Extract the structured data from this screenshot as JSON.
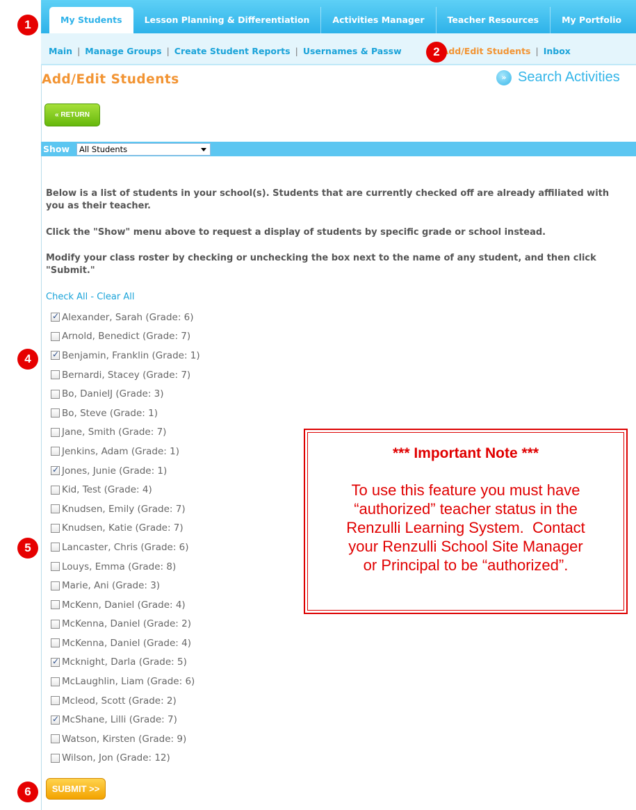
{
  "badges": [
    "1",
    "2",
    "4",
    "5",
    "6"
  ],
  "tabs": [
    "My Students",
    "Lesson Planning & Differentiation",
    "Activities Manager",
    "Teacher Resources",
    "My Portfolio"
  ],
  "subnav": [
    "Main",
    "Manage Groups",
    "Create Student Reports",
    "Usernames & Passw",
    "Add/Edit Students",
    "Inbox"
  ],
  "page_title": "Add/Edit Students",
  "search_activities": "Search Activities",
  "return_label": "« RETURN",
  "show": {
    "label": "Show",
    "selected": "All Students"
  },
  "paragraphs": [
    "Below is a list of students in your school(s). Students that are currently checked off are already affiliated with you as their teacher.",
    "Click the \"Show\" menu above to request a display of students by specific grade or school instead.",
    "Modify your class roster by checking or unchecking the box next to the name of any student, and then click \"Submit.\""
  ],
  "check_all": "Check All",
  "check_sep": " - ",
  "clear_all": "Clear All",
  "students": [
    {
      "name": "Alexander, Sarah (Grade: 6)",
      "checked": true
    },
    {
      "name": "Arnold, Benedict (Grade: 7)",
      "checked": false
    },
    {
      "name": "Benjamin, Franklin (Grade: 1)",
      "checked": true
    },
    {
      "name": "Bernardi, Stacey (Grade: 7)",
      "checked": false
    },
    {
      "name": "Bo, DanielJ (Grade: 3)",
      "checked": false
    },
    {
      "name": "Bo, Steve (Grade: 1)",
      "checked": false
    },
    {
      "name": "Jane, Smith (Grade: 7)",
      "checked": false
    },
    {
      "name": "Jenkins, Adam (Grade: 1)",
      "checked": false
    },
    {
      "name": "Jones, Junie (Grade: 1)",
      "checked": true
    },
    {
      "name": "Kid, Test (Grade: 4)",
      "checked": false
    },
    {
      "name": "Knudsen, Emily (Grade: 7)",
      "checked": false
    },
    {
      "name": "Knudsen, Katie (Grade: 7)",
      "checked": false
    },
    {
      "name": "Lancaster, Chris (Grade: 6)",
      "checked": false
    },
    {
      "name": "Louys, Emma (Grade: 8)",
      "checked": false
    },
    {
      "name": "Marie, Ani (Grade: 3)",
      "checked": false
    },
    {
      "name": "McKenn, Daniel (Grade: 4)",
      "checked": false
    },
    {
      "name": "McKenna, Daniel (Grade: 2)",
      "checked": false
    },
    {
      "name": "McKenna, Daniel (Grade: 4)",
      "checked": false
    },
    {
      "name": "Mcknight, Darla (Grade: 5)",
      "checked": true
    },
    {
      "name": "McLaughlin, Liam (Grade: 6)",
      "checked": false
    },
    {
      "name": "Mcleod, Scott (Grade: 2)",
      "checked": false
    },
    {
      "name": "McShane, Lilli (Grade: 7)",
      "checked": true
    },
    {
      "name": "Watson, Kirsten (Grade: 9)",
      "checked": false
    },
    {
      "name": "Wilson, Jon (Grade: 12)",
      "checked": false
    }
  ],
  "note": {
    "title": "*** Important Note ***",
    "lines": [
      "To use this feature you must have",
      "“authorized” teacher status in the",
      "Renzulli Learning System.  Contact",
      "your Renzulli School Site Manager",
      "or Principal to be “authorized”."
    ]
  },
  "submit_label": "SUBMIT >>"
}
